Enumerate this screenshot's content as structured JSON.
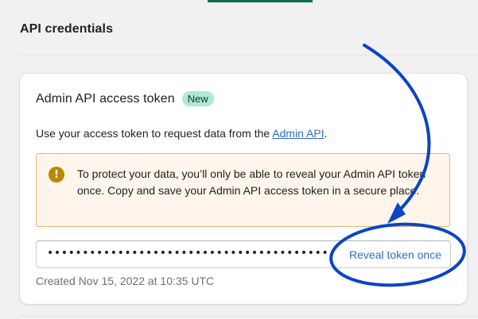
{
  "section": {
    "title": "API credentials"
  },
  "card": {
    "title": "Admin API access token",
    "badge": "New",
    "description_prefix": "Use your access token to request data from the ",
    "description_link": "Admin API",
    "description_suffix": ".",
    "banner": {
      "icon": "warning-icon",
      "icon_glyph": "!",
      "text": "To protect your data, you’ll only be able to reveal your Admin API token once. Copy and save your Admin API access token in a secure place."
    },
    "token": {
      "masked_value": "••••••••••••••••••••••••••••••••••••••••",
      "reveal_label": "Reveal token once"
    },
    "created": "Created Nov 15, 2022 at 10:35 UTC"
  },
  "colors": {
    "badge_bg": "#aee9d1",
    "link": "#2c6ecb",
    "banner_bg": "#fff5ea",
    "banner_border": "#e1b878",
    "warning_icon": "#b98900",
    "annotation": "#0a44c7"
  }
}
